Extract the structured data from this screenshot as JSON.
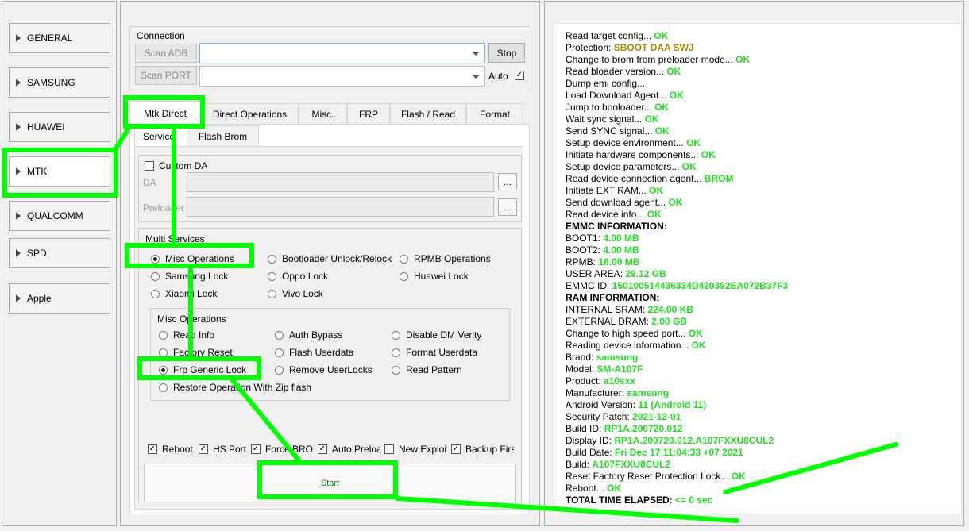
{
  "sidebar": {
    "items": [
      {
        "label": "GENERAL"
      },
      {
        "label": "SAMSUNG"
      },
      {
        "label": "HUAWEI"
      },
      {
        "label": "MTK"
      },
      {
        "label": "QUALCOMM"
      },
      {
        "label": "SPD"
      },
      {
        "label": "Apple"
      }
    ]
  },
  "connection": {
    "title": "Connection",
    "scan_adb": "Scan ADB",
    "scan_port": "Scan PORT",
    "stop": "Stop",
    "auto": "Auto",
    "adb_value": "",
    "port_value": ""
  },
  "tabs": [
    "Mtk Direct",
    "Direct Operations",
    "Misc.",
    "FRP",
    "Flash / Read",
    "Format"
  ],
  "subtabs": [
    "Service",
    "Flash Brom"
  ],
  "custom_da": {
    "label": "Custom DA",
    "da_label": "DA",
    "preloader_label": "Preloader",
    "browse": "..."
  },
  "multi_services": {
    "title": "Multi Services",
    "options": [
      "Misc Operations",
      "Bootloader Unlock/Relock",
      "RPMB Operations",
      "Samsung Lock",
      "Oppo Lock",
      "Huawei Lock",
      "Xiaomi Lock",
      "Vivo Lock"
    ]
  },
  "misc_ops": {
    "title": "Misc Operations",
    "options": [
      "Read Info",
      "Auth Bypass",
      "Disable DM Verity",
      "Factory Reset",
      "Flash Userdata",
      "Format Userdata",
      "Frp Generic Lock",
      "Remove UserLocks",
      "Read Pattern",
      "Restore Operation With Zip flash"
    ]
  },
  "options": [
    "Reboot",
    "HS Port",
    "Force BROM",
    "Auto Preloader",
    "New Exploit",
    "Backup First"
  ],
  "start": "Start",
  "log": [
    {
      "t": "Read target config... ",
      "v": "OK"
    },
    {
      "t": "Protection: ",
      "v": "SBOOT DAA SWJ",
      "c": "warn"
    },
    {
      "t": "Change to brom from preloader mode... ",
      "v": "OK"
    },
    {
      "t": "Read bloader version... ",
      "v": "OK"
    },
    {
      "t": "Dump emi config...",
      "v": ""
    },
    {
      "t": "Load Download Agent... ",
      "v": "OK"
    },
    {
      "t": "Jump to booloader... ",
      "v": "OK"
    },
    {
      "t": "Wait sync signal... ",
      "v": "OK"
    },
    {
      "t": "Send SYNC signal... ",
      "v": "OK"
    },
    {
      "t": "Setup device environment... ",
      "v": "OK"
    },
    {
      "t": "Initiate hardware components... ",
      "v": "OK"
    },
    {
      "t": "Setup device parameters... ",
      "v": "OK"
    },
    {
      "t": "Read device connection agent... ",
      "v": "BROM"
    },
    {
      "t": "Initiate EXT RAM... ",
      "v": "OK"
    },
    {
      "t": "Send download agent... ",
      "v": "OK"
    },
    {
      "t": "Read device info... ",
      "v": "OK"
    },
    {
      "t": "EMMC INFORMATION:",
      "v": "",
      "b": true
    },
    {
      "t": "BOOT1: ",
      "v": "4.00 MB"
    },
    {
      "t": "BOOT2: ",
      "v": "4.00 MB"
    },
    {
      "t": "RPMB: ",
      "v": "16.00 MB"
    },
    {
      "t": "USER AREA: ",
      "v": "29.12 GB"
    },
    {
      "t": "EMMC ID: ",
      "v": "150100514436334D420392EA072B37F3"
    },
    {
      "t": "RAM INFORMATION:",
      "v": "",
      "b": true
    },
    {
      "t": "INTERNAL SRAM: ",
      "v": "224.00 KB"
    },
    {
      "t": "EXTERNAL DRAM: ",
      "v": "2.00 GB"
    },
    {
      "t": "Change to high speed port... ",
      "v": "OK"
    },
    {
      "t": "Reading device information... ",
      "v": "OK"
    },
    {
      "t": " Brand: ",
      "v": "samsung"
    },
    {
      "t": " Model: ",
      "v": "SM-A107F"
    },
    {
      "t": " Product: ",
      "v": "a10sxx"
    },
    {
      "t": " Manufacturer: ",
      "v": "samsung"
    },
    {
      "t": " Android Version: ",
      "v": "11 (Android 11)"
    },
    {
      "t": " Security Patch: ",
      "v": "2021-12-01"
    },
    {
      "t": " Build ID: ",
      "v": "RP1A.200720.012"
    },
    {
      "t": " Display ID: ",
      "v": "RP1A.200720.012.A107FXXU8CUL2"
    },
    {
      "t": " Build Date: ",
      "v": "Fri Dec 17 11:04:33 +07 2021"
    },
    {
      "t": " Build: ",
      "v": "A107FXXU8CUL2"
    },
    {
      "t": "Reset Factory Reset Protection Lock... ",
      "v": "OK"
    },
    {
      "t": " Reboot... ",
      "v": "OK"
    },
    {
      "t": " TOTAL TIME ELAPSED: ",
      "v": "<= 0 sec",
      "b": true
    }
  ],
  "colors": {
    "highlight": "#00ff00",
    "ok": "#22dd22",
    "warn": "#a88a00"
  }
}
